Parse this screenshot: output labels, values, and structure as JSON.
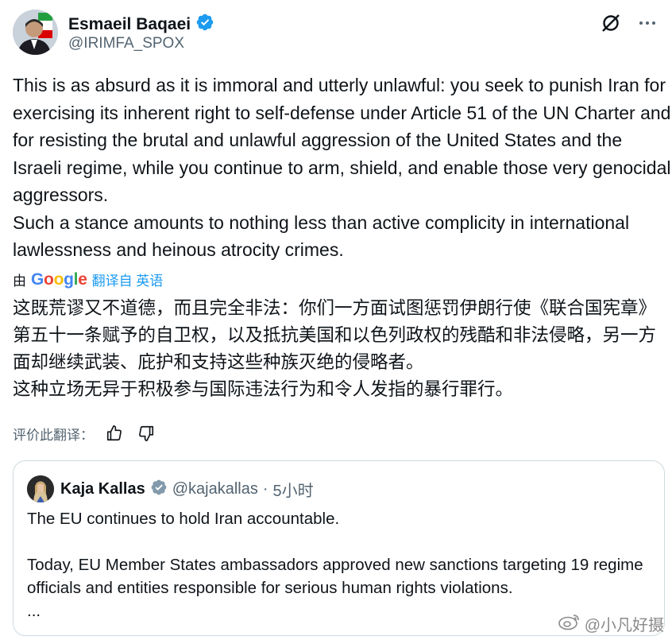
{
  "author": {
    "name": "Esmaeil Baqaei",
    "handle": "@IRIMFA_SPOX"
  },
  "tweet": {
    "text": "This is as absurd as it is immoral and utterly unlawful: you seek to punish Iran for exercising its inherent right to self-defense under Article 51 of the UN Charter and for resisting the brutal and unlawful aggression of the United States and the Israeli regime, while you continue to arm, shield, and enable those very genocidal aggressors.\nSuch a stance amounts to nothing less than active complicity in international lawlessness and heinous atrocity crimes."
  },
  "translation": {
    "by_label": "由",
    "provider": "Google",
    "link_label": "翻译自 英语",
    "text": "这既荒谬又不道德，而且完全非法：你们一方面试图惩罚伊朗行使《联合国宪章》第五十一条赋予的自卫权，以及抵抗美国和以色列政权的残酷和非法侵略，另一方面却继续武装、庇护和支持这些种族灭绝的侵略者。\n这种立场无异于积极参与国际违法行为和令人发指的暴行罪行。",
    "rate_label": "评价此翻译："
  },
  "quote": {
    "name": "Kaja Kallas",
    "handle": "@kajakallas",
    "separator": "·",
    "time": "5小时",
    "text": "The EU continues to hold Iran accountable.\n\nToday, EU Member States ambassadors approved new sanctions targeting 19 regime officials and entities responsible for serious human rights violations.\n..."
  },
  "watermark": {
    "text": "@小凡好摄"
  },
  "icons": {
    "verified": "verified-badge-icon",
    "grok": "grok-icon",
    "more": "more-icon",
    "thumbs_up": "thumbs-up-icon",
    "thumbs_down": "thumbs-down-icon",
    "weibo": "weibo-icon"
  },
  "colors": {
    "text": "#0f1419",
    "secondary": "#536471",
    "link": "#1d9bf0",
    "verified_blue": "#1d9bf0",
    "verified_gray": "#829aab",
    "border": "#cfd9de"
  }
}
